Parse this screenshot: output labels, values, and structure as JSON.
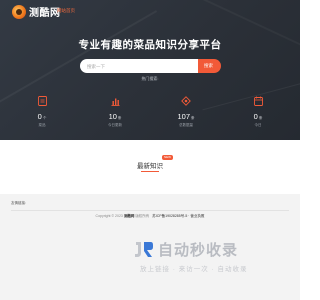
{
  "header": {
    "logo_text": "测酷网",
    "nav_home": "网站首页"
  },
  "hero": {
    "headline": "专业有趣的菜品知识分享平台",
    "search": {
      "placeholder": "搜索一下",
      "button_label": "搜索"
    },
    "hot_label": "热门搜索:"
  },
  "stats": [
    {
      "value": "0",
      "unit": "个",
      "label": "菜品",
      "icon": "document-icon"
    },
    {
      "value": "10",
      "unit": "条",
      "label": "今日更新",
      "icon": "bar-chart-icon"
    },
    {
      "value": "107",
      "unit": "条",
      "label": "总数据量",
      "icon": "diamond-icon"
    },
    {
      "value": "0",
      "unit": "条",
      "label": "今日"
    }
  ],
  "latest": {
    "title": "最新知识",
    "badge": "NEW"
  },
  "footer": {
    "friend_links_label": "友情链接:",
    "copyright_prefix": "Copyright © 2023",
    "brand": "测酷网",
    "rights": "版权所有",
    "icp": "苏ICP备19028285号-5 · 营业执照"
  },
  "watermark": {
    "title": "自动秒收录",
    "subtitle": "放上链接 · 来访一次 · 自动收录"
  },
  "colors": {
    "accent": "#f25a38",
    "hero_bg": "#2e343d",
    "footer_bg": "#f3f3f3"
  }
}
